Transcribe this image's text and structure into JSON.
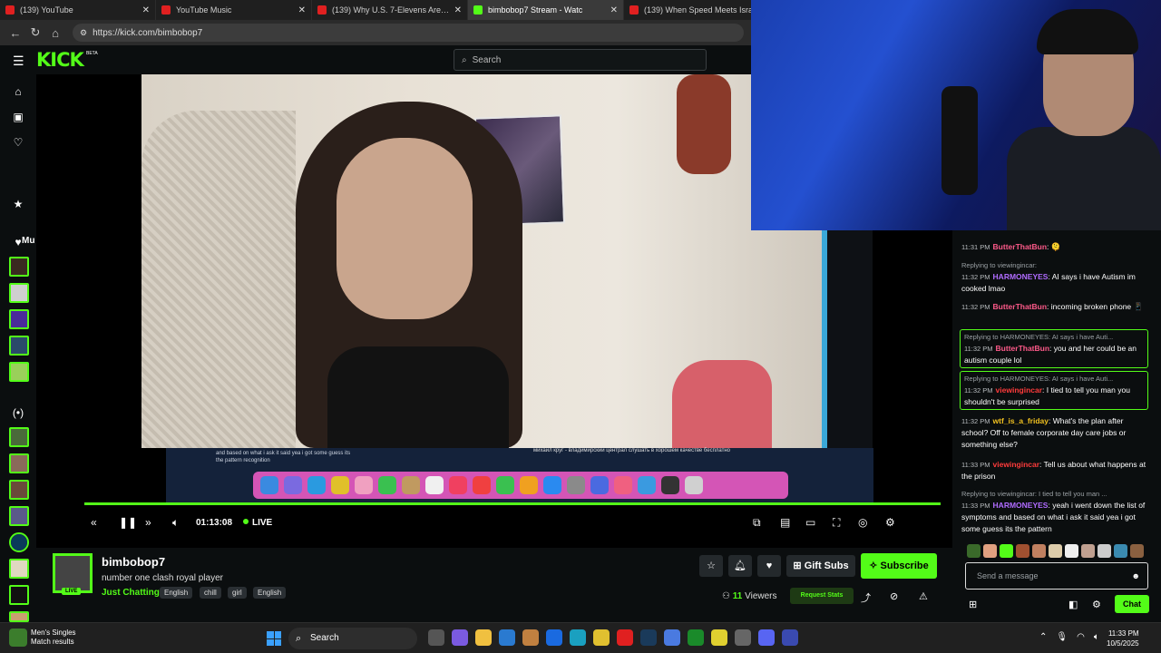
{
  "browser": {
    "tabs": [
      {
        "label": "(139) YouTube",
        "active": false
      },
      {
        "label": "YouTube Music",
        "active": false
      },
      {
        "label": "(139) Why U.S. 7-Elevens Are Ad",
        "active": false
      },
      {
        "label": "bimbobop7 Stream - Watc",
        "active": true
      },
      {
        "label": "(139) When Speed Meets Israeli",
        "active": false
      }
    ],
    "url": "https://kick.com/bimbobop7"
  },
  "kick": {
    "logo": "KICK",
    "beta": "BETA",
    "search_placeholder": "Search",
    "sidebar_label": "Mu"
  },
  "video": {
    "screen_text": "and based on what i ask it said yea i got some guess its the pattern recognition",
    "screen_title": "михаил круг - владимирский централ слушать в хорошем качестве бесплатно",
    "time": "01:13:08",
    "live_label": "LIVE",
    "progress": 1.0
  },
  "channel": {
    "name": "bimbobop7",
    "title": "number one clash royal player",
    "category": "Just Chatting",
    "tags": [
      "English",
      "chill",
      "girl",
      "English"
    ],
    "live_badge": "LIVE",
    "gift_subs": "Gift Subs",
    "subscribe": "Subscribe",
    "viewers_count": "11",
    "viewers_label": "Viewers",
    "request_stats": "Request Stats"
  },
  "chat": {
    "messages": [
      {
        "reply": "",
        "time": "11:31 PM",
        "user": "ButterThatBun",
        "user_color": "#ff5a8a",
        "text": ""
      },
      {
        "reply": "Replying to viewingincar:",
        "time": "11:32 PM",
        "user": "HARMONEYES",
        "user_color": "#b06cff",
        "text": "AI says i have Autism im cooked lmao"
      },
      {
        "reply": "",
        "time": "11:32 PM",
        "user": "ButterThatBun",
        "user_color": "#ff5a8a",
        "text": "incoming broken phone"
      },
      {
        "reply": "Replying to HARMONEYES: AI says i have Auti...",
        "time": "11:32 PM",
        "user": "ButterThatBun",
        "user_color": "#ff5a8a",
        "text": "you and her could be an autism couple lol"
      },
      {
        "reply": "Replying to HARMONEYES: AI says i have Auti...",
        "time": "11:32 PM",
        "user": "viewingincar",
        "user_color": "#ff3b3b",
        "text": "I tied to tell you man you shouldn't be surprised"
      },
      {
        "reply": "",
        "time": "11:32 PM",
        "user": "wtf_is_a_friday",
        "user_color": "#f0c020",
        "text": "What's the plan after school? Off to female corporate day care jobs or something else?"
      },
      {
        "reply": "",
        "time": "11:33 PM",
        "user": "viewingincar",
        "user_color": "#ff3b3b",
        "text": "Tell us about what happens at the prison"
      },
      {
        "reply": "Replying to viewingincar: I tied to tell you man ...",
        "time": "11:33 PM",
        "user": "HARMONEYES",
        "user_color": "#b06cff",
        "text": "yeah i went down the list of symptoms and based on what i ask it said yea i got some guess its the pattern"
      }
    ],
    "input_placeholder": "Send a message",
    "chat_button": "Chat"
  },
  "taskbar": {
    "widget_title": "Men's Singles",
    "widget_sub": "Match results",
    "search": "Search",
    "time": "11:33 PM",
    "date": "10/5/2025"
  },
  "colors": {
    "accent": "#53fc18",
    "background": "#0b0e0f"
  }
}
